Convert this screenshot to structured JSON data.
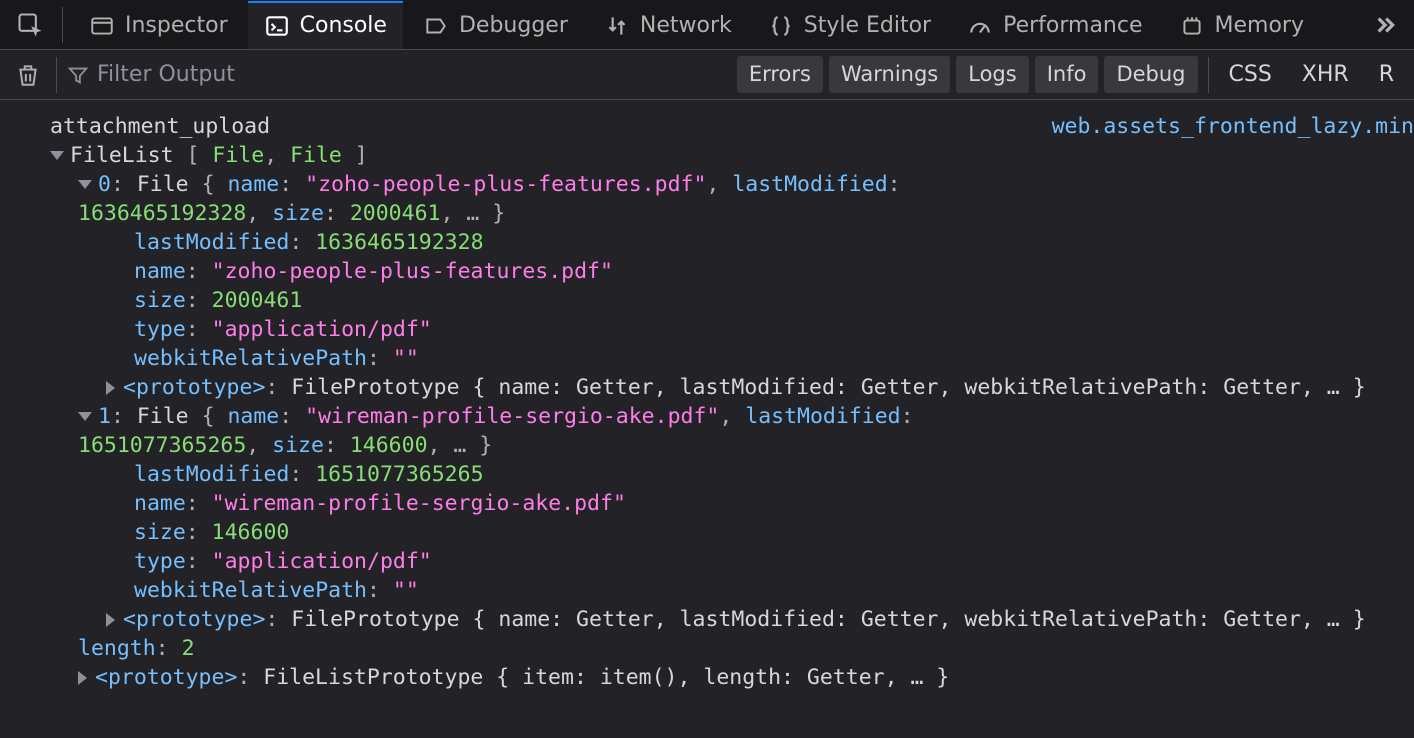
{
  "tabs": {
    "inspector": "Inspector",
    "console": "Console",
    "debugger": "Debugger",
    "network": "Network",
    "style_editor": "Style Editor",
    "performance": "Performance",
    "memory": "Memory"
  },
  "toolbar": {
    "filter_placeholder": "Filter Output",
    "pills": {
      "errors": "Errors",
      "warnings": "Warnings",
      "logs": "Logs",
      "info": "Info",
      "debug": "Debug"
    },
    "extra": {
      "css": "CSS",
      "xhr": "XHR",
      "requests": "R"
    }
  },
  "log": {
    "label": "attachment_upload",
    "source": "web.assets_frontend_lazy.min",
    "filelist_head": "FileList",
    "file_cls": "File",
    "items": [
      {
        "idx": "0",
        "name": "\"zoho-people-plus-features.pdf\"",
        "lastModified": "1636465192328",
        "size": "2000461",
        "type": "\"application/pdf\"",
        "webkitRelativePath": "\"\""
      },
      {
        "idx": "1",
        "name": "\"wireman-profile-sergio-ake.pdf\"",
        "lastModified": "1651077365265",
        "size": "146600",
        "type": "\"application/pdf\"",
        "webkitRelativePath": "\"\""
      }
    ],
    "length_label": "length",
    "length_value": "2",
    "proto_file_summary": "FilePrototype { name: Getter, lastModified: Getter, webkitRelativePath: Getter, … }",
    "proto_filelist_summary": "FileListPrototype { item: item(), length: Getter, … }",
    "k_name": "name",
    "k_lastModified": "lastModified",
    "k_size": "size",
    "k_type": "type",
    "k_webkit": "webkitRelativePath",
    "k_proto": "<prototype>"
  }
}
